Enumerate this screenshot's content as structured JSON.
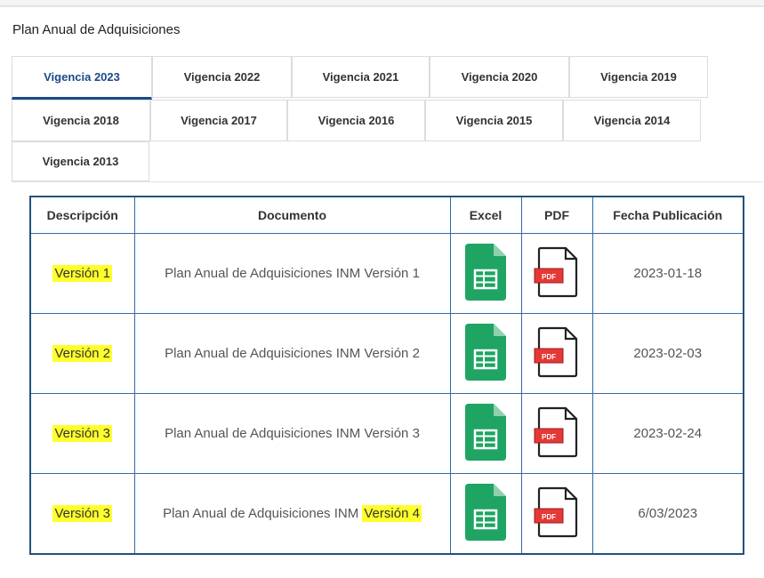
{
  "section": {
    "title": "Plan Anual de Adquisiciones"
  },
  "tabs": [
    {
      "label": "Vigencia 2023",
      "active": true
    },
    {
      "label": "Vigencia 2022"
    },
    {
      "label": "Vigencia 2021"
    },
    {
      "label": "Vigencia 2020"
    },
    {
      "label": "Vigencia 2019"
    },
    {
      "label": "Vigencia 2018"
    },
    {
      "label": "Vigencia 2017"
    },
    {
      "label": "Vigencia 2016"
    },
    {
      "label": "Vigencia 2015"
    },
    {
      "label": "Vigencia 2014"
    },
    {
      "label": "Vigencia 2013"
    }
  ],
  "table": {
    "headers": [
      "Descripción",
      "Documento",
      "Excel",
      "PDF",
      "Fecha Publicación"
    ],
    "rows": [
      {
        "descripcion": "Versión 1",
        "documento_prefix": "Plan Anual de Adquisiciones INM Versión 1",
        "documento_highlight": "",
        "fecha": "2023-01-18"
      },
      {
        "descripcion": "Versión 2",
        "documento_prefix": "Plan Anual de Adquisiciones INM Versión 2",
        "documento_highlight": "",
        "fecha": "2023-02-03"
      },
      {
        "descripcion": "Versión 3",
        "documento_prefix": "Plan Anual de Adquisiciones INM Versión 3",
        "documento_highlight": "",
        "fecha": "2023-02-24"
      },
      {
        "descripcion": "Versión 3",
        "documento_prefix": "Plan Anual de Adquisiciones INM ",
        "documento_highlight": "Versión 4",
        "fecha": "6/03/2023"
      }
    ]
  },
  "icons": {
    "excel": "google-sheets-icon",
    "pdf": "pdf-file-icon",
    "pdf_badge": "PDF"
  },
  "colors": {
    "highlight": "#ffff2b",
    "table_border": "#23527c",
    "active_tab": "#1a4a8a",
    "sheets_green": "#1fa463"
  }
}
